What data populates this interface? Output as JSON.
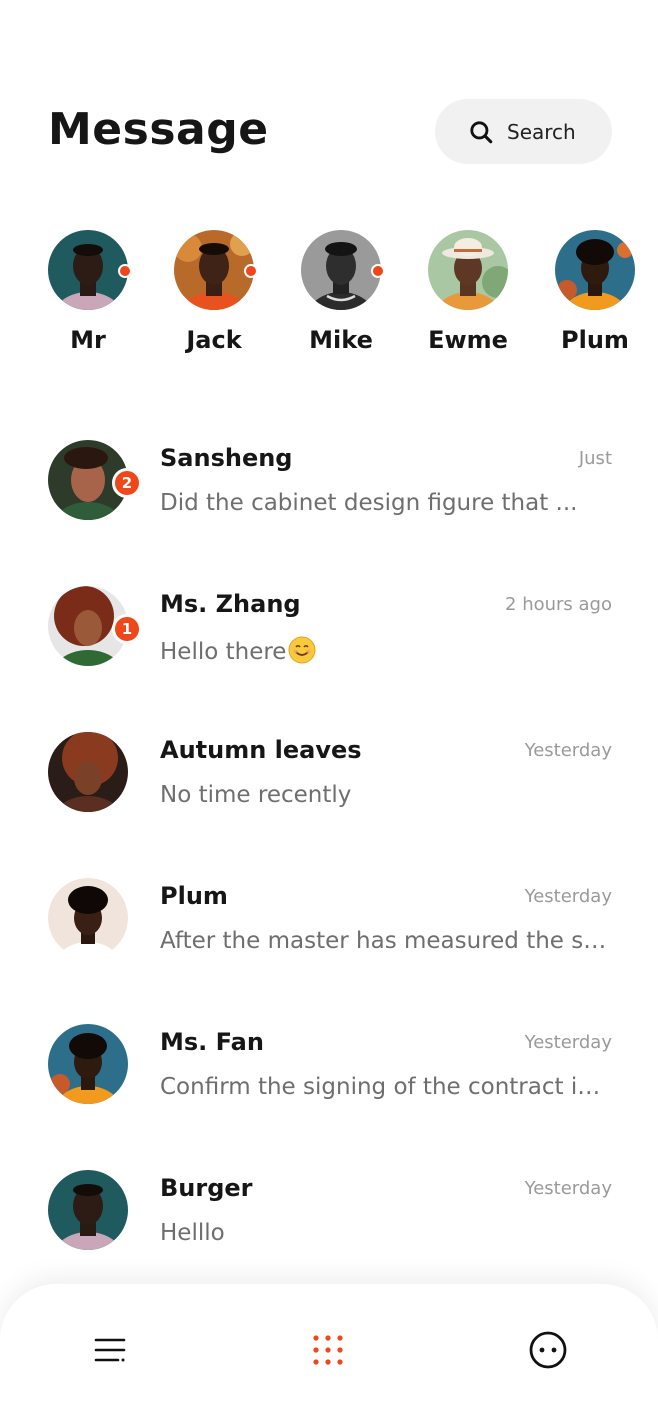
{
  "header": {
    "title": "Message",
    "search_label": "Search"
  },
  "stories": [
    {
      "name": "Mr",
      "online": true
    },
    {
      "name": "Jack",
      "online": true
    },
    {
      "name": "Mike",
      "online": true
    },
    {
      "name": "Ewme",
      "online": false
    },
    {
      "name": "Plum",
      "online": false
    }
  ],
  "conversations": [
    {
      "name": "Sansheng",
      "time": "Just",
      "message": "Did the cabinet design figure that ...",
      "unread": "2"
    },
    {
      "name": "Ms. Zhang",
      "time": "2 hours ago",
      "message": "Hello there",
      "unread": "1"
    },
    {
      "name": "Autumn leaves",
      "time": "Yesterday",
      "message": "No time recently"
    },
    {
      "name": "Plum",
      "time": "Yesterday",
      "message": "After the master has measured the siz..."
    },
    {
      "name": "Ms. Fan",
      "time": "Yesterday",
      "message": "Confirm the signing of the contract in ..."
    },
    {
      "name": "Burger",
      "time": "Yesterday",
      "message": "Helllo"
    }
  ],
  "nav": {
    "icons": [
      "menu-icon",
      "apps-grid-icon",
      "chat-bubble-icon"
    ],
    "active": "apps-grid-icon"
  },
  "colors": {
    "accent": "#f0471a",
    "text": "#161616",
    "muted": "#9a9a9a",
    "search_bg": "#f1f1f1"
  }
}
